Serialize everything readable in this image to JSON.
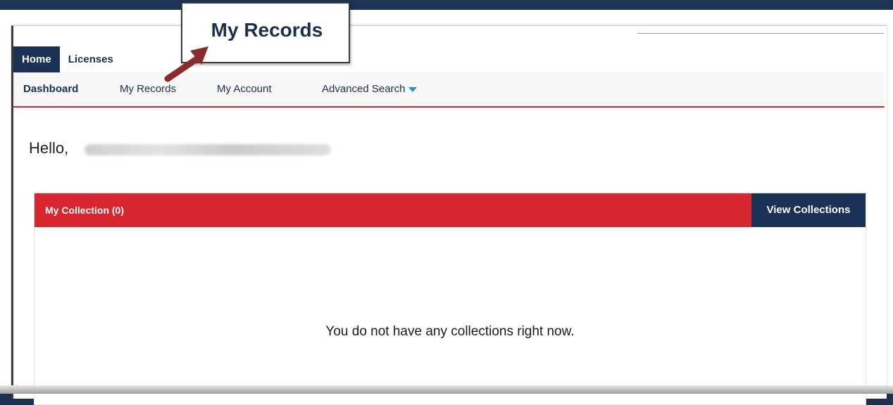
{
  "callout": {
    "label": "My Records"
  },
  "main_tabs": [
    {
      "label": "Home",
      "active": true
    },
    {
      "label": "Licenses",
      "active": false
    }
  ],
  "subnav": [
    {
      "label": "Dashboard",
      "active": true
    },
    {
      "label": "My Records",
      "active": false
    },
    {
      "label": "My Account",
      "active": false
    },
    {
      "label": "Advanced Search",
      "active": false,
      "dropdown": true
    }
  ],
  "greeting": {
    "prefix": "Hello,"
  },
  "collection": {
    "title": "My Collection (0)",
    "view_button": "View Collections",
    "empty_message": "You do not have any collections right now."
  },
  "colors": {
    "navy": "#1c3156",
    "red": "#d7262e",
    "caret_blue": "#2d8fd6",
    "arrow": "#8b2a2a"
  }
}
